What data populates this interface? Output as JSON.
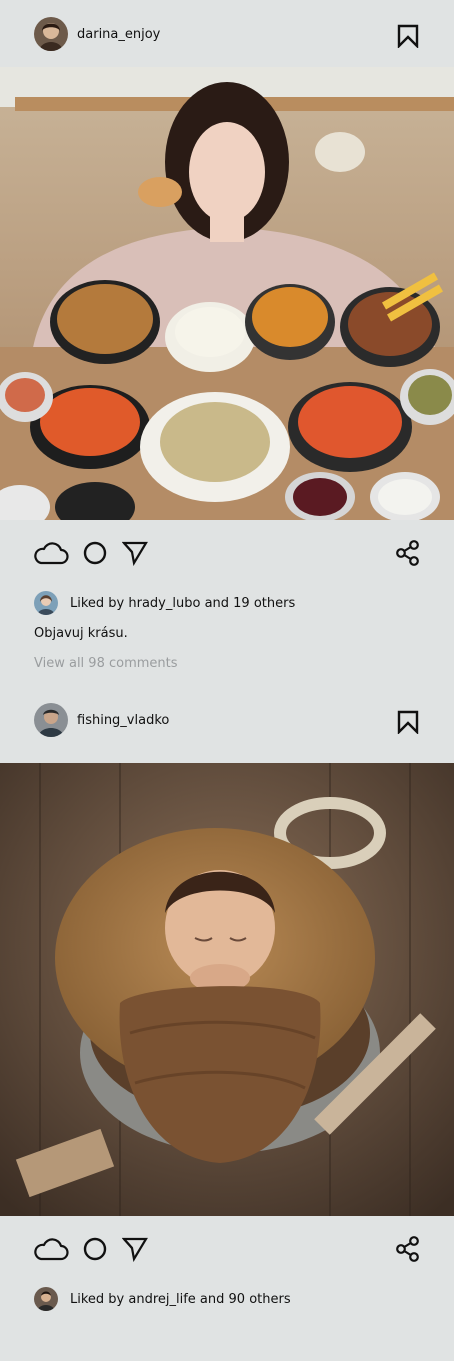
{
  "posts": [
    {
      "username": "darina_enjoy",
      "likes_text": "Liked by hrady_lubo and 19 others",
      "caption": "Objavuj krásu.",
      "comments_link": "View all 98 comments"
    },
    {
      "username": "fishing_vladko",
      "likes_text": "Liked by andrej_life and 90 others"
    }
  ],
  "icons": {
    "like": "cloud-icon",
    "comment": "circle-icon",
    "send": "send-icon",
    "share": "share-icon",
    "save": "bookmark-icon"
  },
  "colors": {
    "background": "#e0e3e3",
    "muted_text": "#9a9d9f"
  }
}
